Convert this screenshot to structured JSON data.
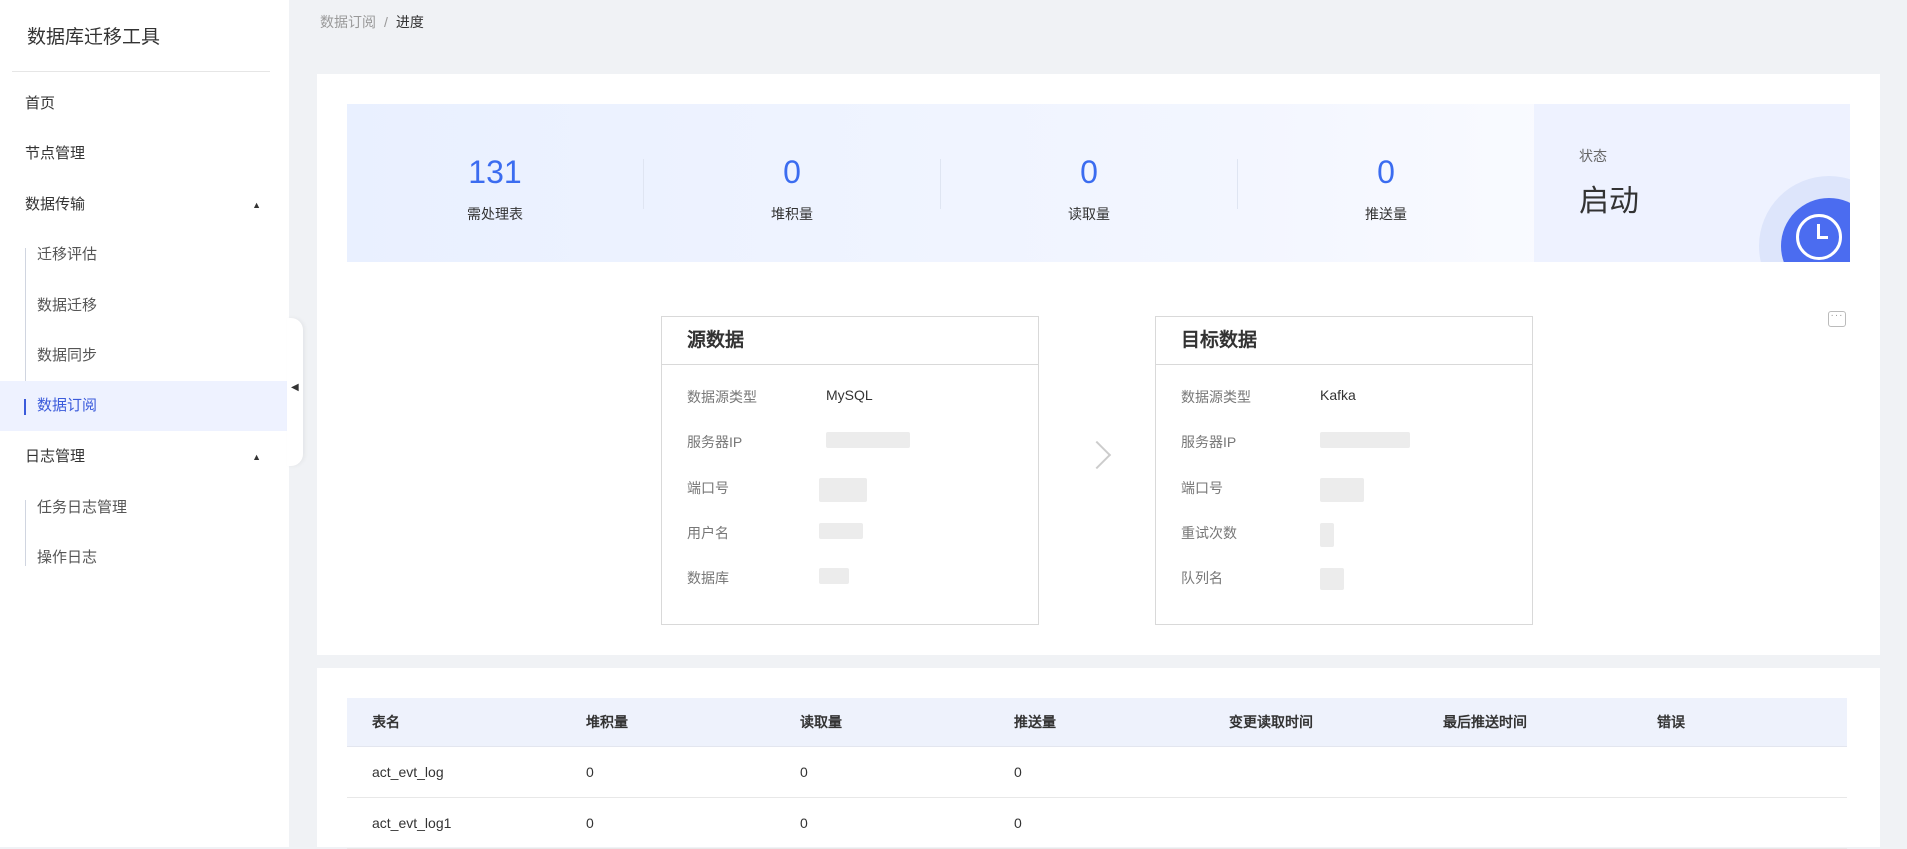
{
  "app": {
    "title": "数据库迁移工具"
  },
  "sidebar": {
    "items": [
      {
        "label": "首页"
      },
      {
        "label": "节点管理"
      },
      {
        "label": "数据传输",
        "children": [
          {
            "label": "迁移评估"
          },
          {
            "label": "数据迁移"
          },
          {
            "label": "数据同步"
          },
          {
            "label": "数据订阅",
            "active": true
          }
        ]
      },
      {
        "label": "日志管理",
        "children": [
          {
            "label": "任务日志管理"
          },
          {
            "label": "操作日志"
          }
        ]
      }
    ]
  },
  "breadcrumb": {
    "parent": "数据订阅",
    "separator": "/",
    "current": "进度"
  },
  "stats": [
    {
      "value": "131",
      "label": "需处理表"
    },
    {
      "value": "0",
      "label": "堆积量"
    },
    {
      "value": "0",
      "label": "读取量"
    },
    {
      "value": "0",
      "label": "推送量"
    }
  ],
  "status": {
    "label": "状态",
    "value": "启动",
    "icon": "clock-icon"
  },
  "source": {
    "title": "源数据",
    "rows": [
      {
        "label": "数据源类型",
        "value": "MySQL"
      },
      {
        "label": "服务器IP",
        "value": ""
      },
      {
        "label": "端口号",
        "value": ""
      },
      {
        "label": "用户名",
        "value": ""
      },
      {
        "label": "数据库",
        "value": ""
      }
    ]
  },
  "target": {
    "title": "目标数据",
    "rows": [
      {
        "label": "数据源类型",
        "value": "Kafka"
      },
      {
        "label": "服务器IP",
        "value": ""
      },
      {
        "label": "端口号",
        "value": ""
      },
      {
        "label": "重试次数",
        "value": ""
      },
      {
        "label": "队列名",
        "value": ""
      }
    ]
  },
  "table": {
    "columns": [
      "表名",
      "堆积量",
      "读取量",
      "推送量",
      "变更读取时间",
      "最后推送时间",
      "错误"
    ],
    "rows": [
      [
        "act_evt_log",
        "0",
        "0",
        "0",
        "",
        "",
        ""
      ],
      [
        "act_evt_log1",
        "0",
        "0",
        "0",
        "",
        "",
        ""
      ]
    ]
  },
  "colors": {
    "accent": "#3b6cf0",
    "active_nav": "#3b5bdb",
    "stats_bg": "#e9f0ff"
  }
}
